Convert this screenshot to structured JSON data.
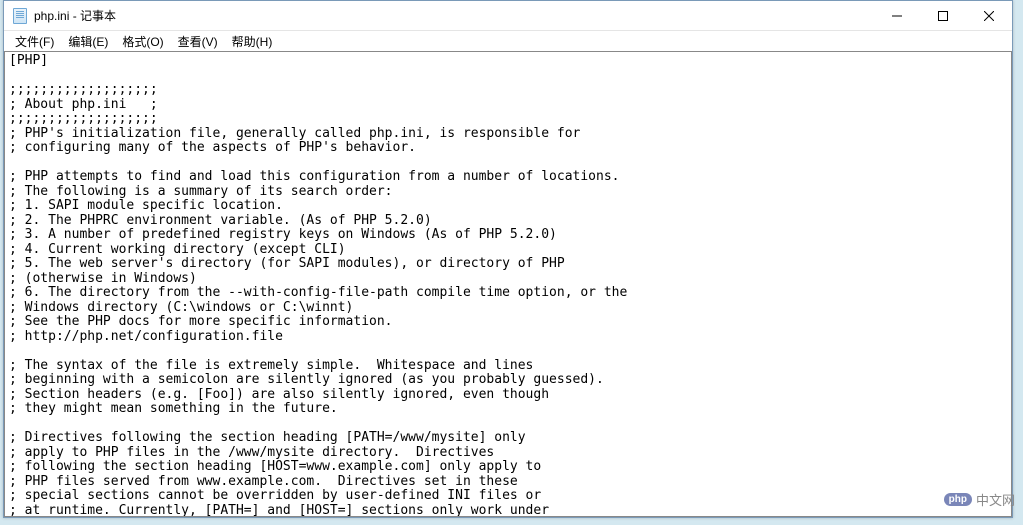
{
  "window": {
    "title": "php.ini - 记事本"
  },
  "menu": {
    "file": "文件(F)",
    "edit": "编辑(E)",
    "format": "格式(O)",
    "view": "查看(V)",
    "help": "帮助(H)"
  },
  "editor": {
    "content": "[PHP]\n\n;;;;;;;;;;;;;;;;;;;\n; About php.ini   ;\n;;;;;;;;;;;;;;;;;;;\n; PHP's initialization file, generally called php.ini, is responsible for\n; configuring many of the aspects of PHP's behavior.\n\n; PHP attempts to find and load this configuration from a number of locations.\n; The following is a summary of its search order:\n; 1. SAPI module specific location.\n; 2. The PHPRC environment variable. (As of PHP 5.2.0)\n; 3. A number of predefined registry keys on Windows (As of PHP 5.2.0)\n; 4. Current working directory (except CLI)\n; 5. The web server's directory (for SAPI modules), or directory of PHP\n; (otherwise in Windows)\n; 6. The directory from the --with-config-file-path compile time option, or the\n; Windows directory (C:\\windows or C:\\winnt)\n; See the PHP docs for more specific information.\n; http://php.net/configuration.file\n\n; The syntax of the file is extremely simple.  Whitespace and lines\n; beginning with a semicolon are silently ignored (as you probably guessed).\n; Section headers (e.g. [Foo]) are also silently ignored, even though\n; they might mean something in the future.\n\n; Directives following the section heading [PATH=/www/mysite] only\n; apply to PHP files in the /www/mysite directory.  Directives\n; following the section heading [HOST=www.example.com] only apply to\n; PHP files served from www.example.com.  Directives set in these\n; special sections cannot be overridden by user-defined INI files or\n; at runtime. Currently, [PATH=] and [HOST=] sections only work under\n; CGI/FastCGI.\n; http://php.net/ini.sections\n"
  },
  "watermark": {
    "badge": "php",
    "text": "中文网"
  }
}
